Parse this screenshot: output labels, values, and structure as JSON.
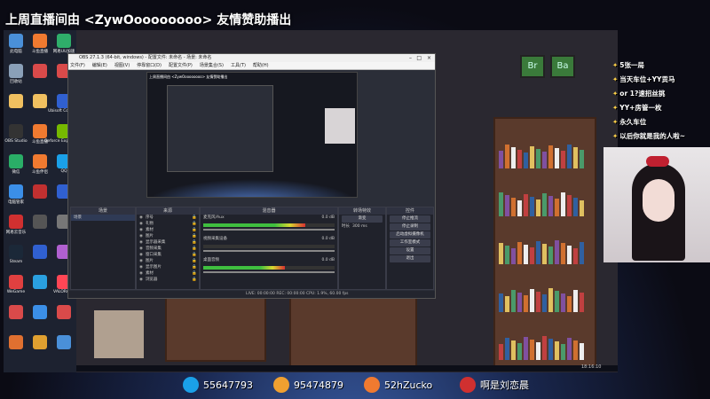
{
  "banner": "上周直播间由 <ZywOoooooooo> 友情赞助播出",
  "desktop_icons": [
    {
      "label": "此电脑",
      "color": "#4a90d9"
    },
    {
      "label": "斗鱼直播",
      "color": "#f07a30"
    },
    {
      "label": "网易UU加速",
      "color": "#2fae6a"
    },
    {
      "label": "回收站",
      "color": "#8aa0b8"
    },
    {
      "label": "",
      "color": "#d94a4a"
    },
    {
      "label": "",
      "color": "#d94a4a"
    },
    {
      "label": "",
      "color": "#f0c060"
    },
    {
      "label": "",
      "color": "#f0c060"
    },
    {
      "label": "Ubisoft Connect",
      "color": "#3060d0"
    },
    {
      "label": "OBS Studio",
      "color": "#333333"
    },
    {
      "label": "斗鱼直播",
      "color": "#f07a30"
    },
    {
      "label": "Geforce Experience",
      "color": "#76b900"
    },
    {
      "label": "微信",
      "color": "#2aae67"
    },
    {
      "label": "斗鱼伴侣",
      "color": "#f07a30"
    },
    {
      "label": "QQ",
      "color": "#1aa0e8"
    },
    {
      "label": "电脑管家",
      "color": "#3b8fe8"
    },
    {
      "label": "",
      "color": "#c03030"
    },
    {
      "label": "",
      "color": "#3060d0"
    },
    {
      "label": "网易云音乐",
      "color": "#d03030"
    },
    {
      "label": "",
      "color": "#555555"
    },
    {
      "label": "",
      "color": "#777777"
    },
    {
      "label": "Steam",
      "color": "#1b2838"
    },
    {
      "label": "",
      "color": "#3060d0"
    },
    {
      "label": "",
      "color": "#b060d0"
    },
    {
      "label": "WeGame",
      "color": "#e04040"
    },
    {
      "label": "",
      "color": "#2aa0e0"
    },
    {
      "label": "VALORANT",
      "color": "#ff4655"
    },
    {
      "label": "",
      "color": "#d94a4a"
    },
    {
      "label": "",
      "color": "#3b8fe8"
    },
    {
      "label": "",
      "color": "#d94a4a"
    },
    {
      "label": "",
      "color": "#e07030"
    },
    {
      "label": "",
      "color": "#e0a030"
    },
    {
      "label": "",
      "color": "#4a90d9"
    }
  ],
  "obs": {
    "title": "OBS 27.1.3 (64-bit, windows) - 配置文件: 未命名 - 场景: 未命名",
    "menu": [
      "文件(F)",
      "编辑(E)",
      "视图(V)",
      "停靠窗口(D)",
      "配置文件(P)",
      "场景集合(S)",
      "工具(T)",
      "帮助(H)"
    ],
    "preview_title": "上周直播间由 <ZywOoooooooo> 友情赞助播出",
    "scenes_header": "场景",
    "scenes": [
      "场景"
    ],
    "sources_header": "来源",
    "sources": [
      "序号",
      "礼物",
      "素材",
      "图片",
      "显示器采集",
      "音频采集",
      "窗口采集",
      "图片",
      "显示图片",
      "素材",
      "浏览器"
    ],
    "mixer_header": "混音器",
    "mixer": [
      {
        "name": "麦克风/Aux",
        "db": "0.0 dB",
        "level": 0.78
      },
      {
        "name": "视频采集设备",
        "db": "0.0 dB",
        "level": 0.0
      },
      {
        "name": "桌面音频",
        "db": "0.0 dB",
        "level": 0.62
      }
    ],
    "transitions_header": "转场特效",
    "transition_type": "渐变",
    "duration_label": "时长",
    "duration_value": "300 ms",
    "controls_header": "控件",
    "controls": [
      "停止推流",
      "停止录制",
      "启动虚拟摄像机",
      "工作室模式",
      "设置",
      "退出"
    ],
    "status": "LIVE: 00:00:00    REC: 00:00:00    CPU: 1.9%, 60.00 fps"
  },
  "danmaku": [
    "5张一局",
    "当天车位+YY贡马",
    "or 1?速招丝挑",
    "YY+房管一枚",
    "永久车位",
    "以后你就是我的人啦~"
  ],
  "social": [
    {
      "icon": "qq-icon",
      "text": "55647793",
      "color": "#1aa0e8"
    },
    {
      "icon": "fox-icon",
      "text": "95474879",
      "color": "#f0a030"
    },
    {
      "icon": "douyu-icon",
      "text": "52hZucko",
      "color": "#f07a30"
    },
    {
      "icon": "weibo-icon",
      "text": "啊是刘恋晨",
      "color": "#d03030"
    }
  ],
  "clock": "18:16:10",
  "colors": {
    "accent": "#f07a30",
    "obs_bg": "#2b2e38",
    "danmaku_gold": "#ffd24a"
  }
}
